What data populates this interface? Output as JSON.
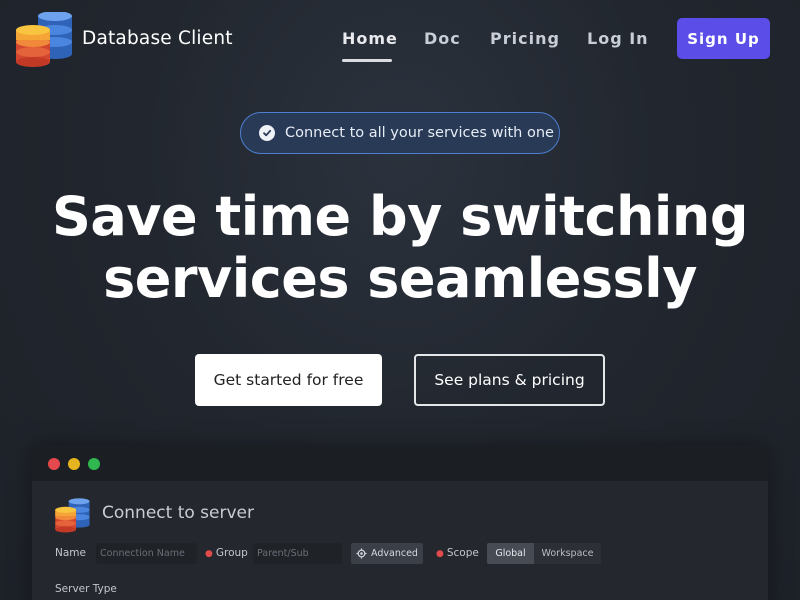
{
  "nav": {
    "brand": "Database Client",
    "links": [
      "Home",
      "Doc",
      "Pricing",
      "Log In"
    ],
    "active": "Home",
    "signup_label": "Sign Up"
  },
  "badge": {
    "text": "Connect to all your services with one",
    "icon": "check-circle-icon"
  },
  "hero": {
    "title_line1": "Save time by switching",
    "title_line2": "services seamlessly"
  },
  "cta": {
    "primary": "Get started for free",
    "secondary": "See plans & pricing"
  },
  "app_window": {
    "title": "Connect to server",
    "name_label": "Name",
    "name_placeholder": "Connection Name",
    "group_label": "Group",
    "group_placeholder": "Parent/Sub",
    "advanced_label": "Advanced",
    "scope_label": "Scope",
    "scope_options": [
      "Global",
      "Workspace"
    ],
    "scope_selected": "Global",
    "server_type_label": "Server Type"
  },
  "colors": {
    "accent": "#5b4de8",
    "badge_border": "#4d7fd0",
    "traffic_red": "#e5484d",
    "traffic_yellow": "#e6b41f",
    "traffic_green": "#2fb84f"
  }
}
